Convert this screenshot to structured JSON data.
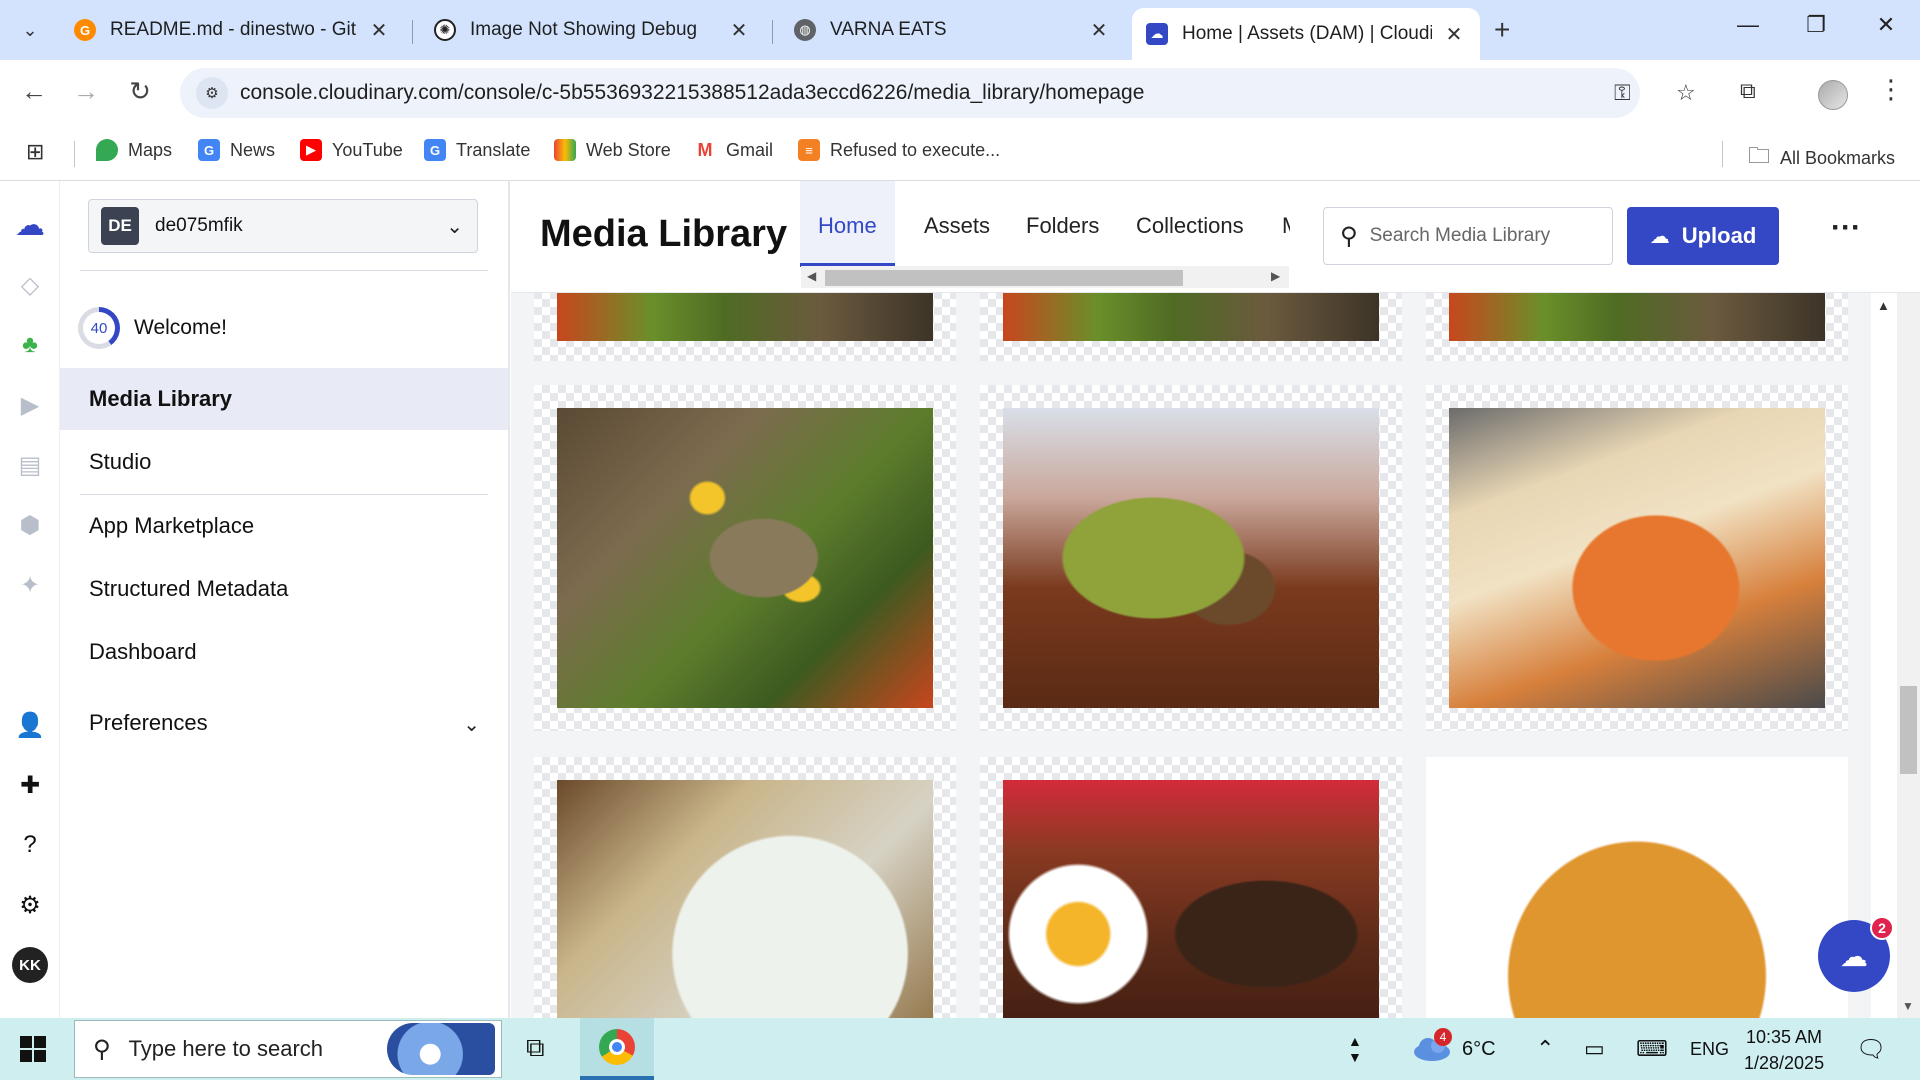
{
  "browser": {
    "tabs": [
      {
        "title": "README.md - dinestwo - Gitpod",
        "icon": "gitpod-icon",
        "active": false
      },
      {
        "title": "Image Not Showing Debug",
        "icon": "openai-icon",
        "active": false
      },
      {
        "title": "VARNA EATS",
        "icon": "globe-icon",
        "active": false
      },
      {
        "title": "Home | Assets (DAM) | Cloudinary",
        "icon": "cloudinary-icon",
        "active": true
      }
    ],
    "url": "console.cloudinary.com/console/c-5b5536932215388512ada3eccd6226/media_library/homepage",
    "bookmarks": [
      {
        "label": "Maps",
        "icon": "maps-icon",
        "color": "#34a853"
      },
      {
        "label": "News",
        "icon": "news-icon",
        "color": "#4285f4"
      },
      {
        "label": "YouTube",
        "icon": "youtube-icon",
        "color": "#ff0000"
      },
      {
        "label": "Translate",
        "icon": "translate-icon",
        "color": "#4285f4"
      },
      {
        "label": "Web Store",
        "icon": "webstore-icon",
        "color": "#ea4335"
      },
      {
        "label": "Gmail",
        "icon": "gmail-icon",
        "color": "#ea4335"
      },
      {
        "label": "Refused to execute...",
        "icon": "stackoverflow-icon",
        "color": "#f48024"
      }
    ],
    "all_bookmarks": "All Bookmarks"
  },
  "sidebar": {
    "account_badge": "DE",
    "account_name": "de075mfik",
    "welcome_progress": "40",
    "welcome": "Welcome!",
    "items": [
      {
        "label": "Media Library",
        "active": true
      },
      {
        "label": "Studio",
        "active": false
      },
      {
        "label": "App Marketplace",
        "active": false
      },
      {
        "label": "Structured Metadata",
        "active": false
      },
      {
        "label": "Dashboard",
        "active": false
      },
      {
        "label": "Preferences",
        "active": false,
        "expandable": true
      }
    ],
    "user_initials": "KK"
  },
  "header": {
    "title": "Media Library",
    "tabs": [
      "Home",
      "Assets",
      "Folders",
      "Collections",
      "M"
    ],
    "active_tab": "Home",
    "search_placeholder": "Search Media Library",
    "upload_label": "Upload"
  },
  "assets": [
    {
      "subject": "grilled fish with salad (partial)"
    },
    {
      "subject": "grilled fish with salad (partial)"
    },
    {
      "subject": "grilled fish with salad (partial)"
    },
    {
      "subject": "grilled fish with lemon slices"
    },
    {
      "subject": "stuffed green pepper"
    },
    {
      "subject": "pumpkin banitsa"
    },
    {
      "subject": "tarator soup with cucumber"
    },
    {
      "subject": "eggs in clay pot"
    },
    {
      "subject": "spiral banitsa pastry"
    }
  ],
  "chat_badge_count": "2",
  "taskbar": {
    "search_placeholder": "Type here to search",
    "weather_badge": "4",
    "temperature": "6°C",
    "language": "ENG",
    "time": "10:35 AM",
    "date": "1/28/2025"
  },
  "colors": {
    "accent": "#3448c5",
    "tabstrip": "#d3e3fd",
    "taskbar": "#cfeef0"
  }
}
